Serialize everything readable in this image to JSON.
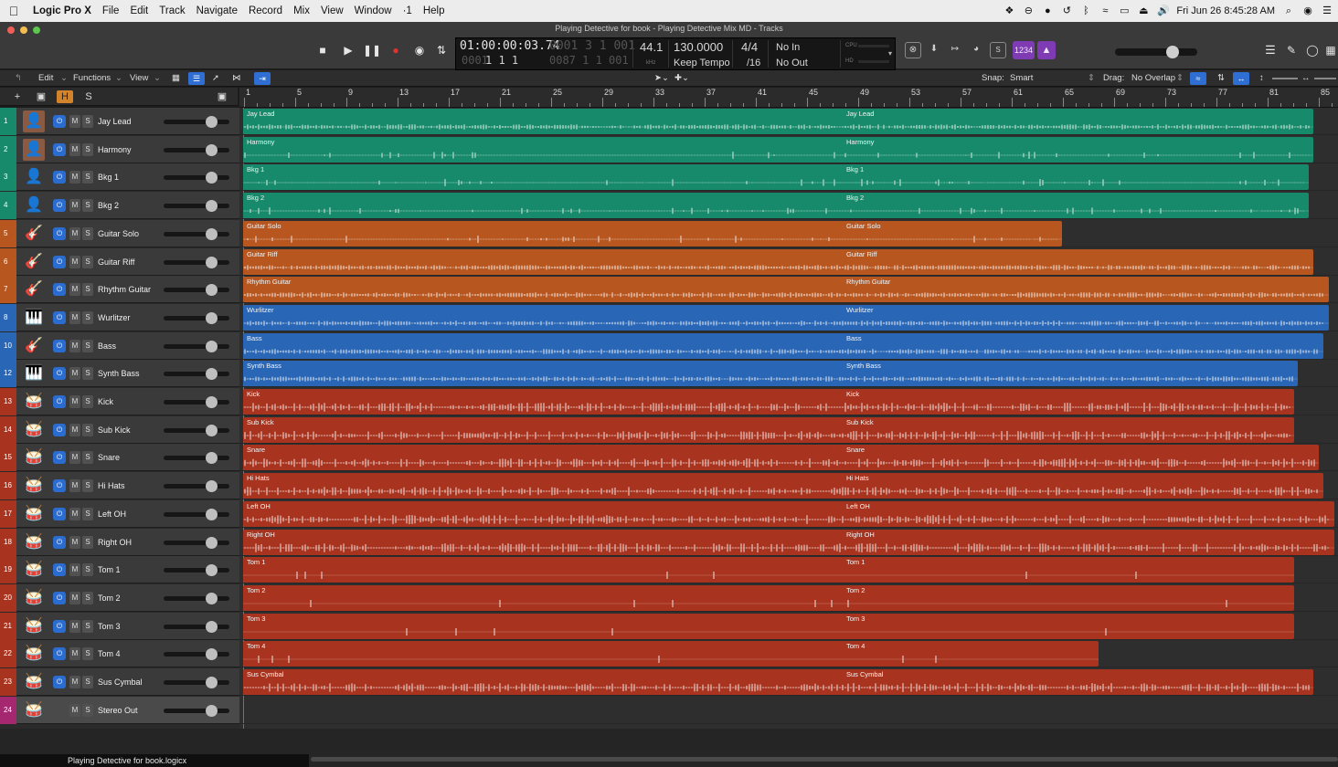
{
  "menubar": {
    "app": "Logic Pro X",
    "items": [
      "File",
      "Edit",
      "Track",
      "Navigate",
      "Record",
      "Mix",
      "View",
      "Window",
      "·1",
      "Help"
    ],
    "clock": "Fri Jun 26  8:45:28 AM"
  },
  "window": {
    "title": "Playing Detective for book - Playing Detective Mix MD - Tracks"
  },
  "lcd": {
    "timecode": "01:00:00:03.74",
    "timecode_dim": "0001 3 1 001",
    "position": "1  1  1",
    "position_dim": "0087 1 1 001",
    "sample_rate": "44.1",
    "sample_unit": "kHz",
    "tempo": "130.0000",
    "tempo_mode": "Keep Tempo",
    "time_sig": "4/4",
    "division": "/16",
    "in": "No In",
    "out": "No Out",
    "cpu": "CPU",
    "hd": "HD"
  },
  "toolbar": {
    "edit": "Edit",
    "functions": "Functions",
    "view": "View",
    "snap_label": "Snap:",
    "snap_value": "Smart",
    "drag_label": "Drag:",
    "drag_value": "No Overlap",
    "count_in": "1234"
  },
  "tracklist_header": {
    "h": "H",
    "s": "S"
  },
  "ruler": {
    "marks": [
      "1",
      "5",
      "9",
      "13",
      "17",
      "21",
      "25",
      "29",
      "33",
      "37",
      "41",
      "45",
      "49",
      "53",
      "57",
      "61",
      "65",
      "69",
      "73",
      "77",
      "81",
      "85"
    ]
  },
  "colors": {
    "green": "#168a6a",
    "orange": "#b7561f",
    "blue": "#2966b5",
    "red": "#a8341f",
    "pink": "#a4276f"
  },
  "tracks": [
    {
      "num": "1",
      "name": "Jay Lead",
      "icon": "portrait-icon",
      "color": "green",
      "region": "Jay Lead"
    },
    {
      "num": "2",
      "name": "Harmony",
      "icon": "portrait-icon",
      "color": "green",
      "region": "Harmony"
    },
    {
      "num": "3",
      "name": "Bkg 1",
      "icon": "singer-icon",
      "color": "green",
      "region": "Bkg 1"
    },
    {
      "num": "4",
      "name": "Bkg 2",
      "icon": "singer-icon",
      "color": "green",
      "region": "Bkg 2"
    },
    {
      "num": "5",
      "name": "Guitar Solo",
      "icon": "guitar-icon",
      "color": "orange",
      "region": "Guitar Solo"
    },
    {
      "num": "6",
      "name": "Guitar Riff",
      "icon": "guitar-icon",
      "color": "orange",
      "region": "Guitar Riff"
    },
    {
      "num": "7",
      "name": "Rhythm Guitar",
      "icon": "acoustic-guitar-icon",
      "color": "orange",
      "region": "Rhythm Guitar"
    },
    {
      "num": "8",
      "name": "Wurlitzer",
      "icon": "keyboard-icon",
      "color": "blue",
      "region": "Wurlitzer"
    },
    {
      "num": "10",
      "name": "Bass",
      "icon": "bass-icon",
      "color": "blue",
      "region": "Bass"
    },
    {
      "num": "12",
      "name": "Synth Bass",
      "icon": "synth-icon",
      "color": "blue",
      "region": "Synth Bass"
    },
    {
      "num": "13",
      "name": "Kick",
      "icon": "drum-kit-icon",
      "color": "red",
      "region": "Kick"
    },
    {
      "num": "14",
      "name": "Sub Kick",
      "icon": "drum-kit-icon",
      "color": "red",
      "region": "Sub Kick"
    },
    {
      "num": "15",
      "name": "Snare",
      "icon": "drum-kit-icon",
      "color": "red",
      "region": "Snare"
    },
    {
      "num": "16",
      "name": "Hi Hats",
      "icon": "drum-kit-icon",
      "color": "red",
      "region": "Hi Hats"
    },
    {
      "num": "17",
      "name": "Left OH",
      "icon": "drum-kit-icon",
      "color": "red",
      "region": "Left OH"
    },
    {
      "num": "18",
      "name": "Right OH",
      "icon": "drum-kit-icon",
      "color": "red",
      "region": "Right OH"
    },
    {
      "num": "19",
      "name": "Tom 1",
      "icon": "drum-kit-icon",
      "color": "red",
      "region": "Tom 1"
    },
    {
      "num": "20",
      "name": "Tom 2",
      "icon": "drum-kit-icon",
      "color": "red",
      "region": "Tom 2"
    },
    {
      "num": "21",
      "name": "Tom 3",
      "icon": "drum-kit-icon",
      "color": "red",
      "region": "Tom 3"
    },
    {
      "num": "22",
      "name": "Tom 4",
      "icon": "drum-kit-icon",
      "color": "red",
      "region": "Tom 4"
    },
    {
      "num": "23",
      "name": "Sus Cymbal",
      "icon": "drum-kit-icon",
      "color": "red",
      "region": "Sus Cymbal"
    },
    {
      "num": "24",
      "name": "Stereo Out",
      "icon": "drum-kit-icon",
      "color": "pink",
      "region": ""
    }
  ],
  "status": {
    "file": "Playing Detective for book.logicx"
  }
}
